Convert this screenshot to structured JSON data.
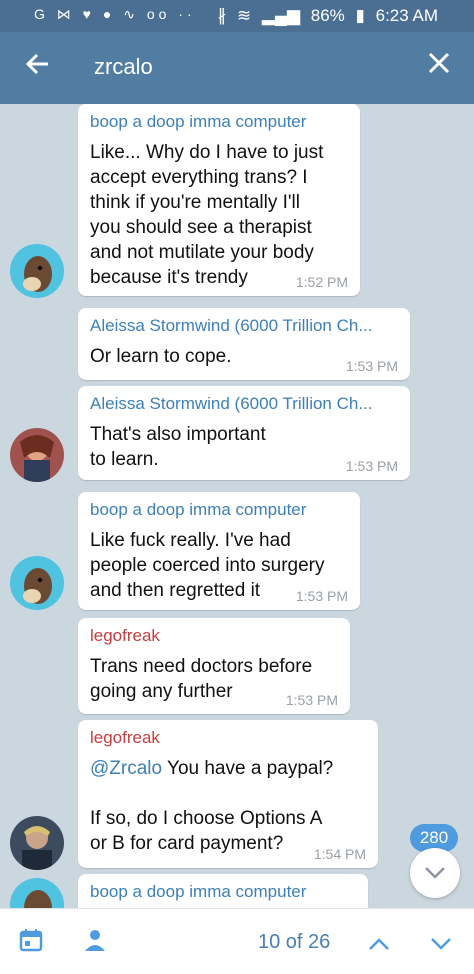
{
  "status_bar": {
    "left_icons": "G ⋈ ♥ ● ∿ oo ··",
    "battery": "86%",
    "time": "6:23 AM"
  },
  "header": {
    "back_icon": "arrow-left",
    "title": "zrcalo",
    "close_icon": "close"
  },
  "messages": [
    {
      "sender": "boop a doop imma computer",
      "text": "Like... Why do I have to just\naccept everything trans? I\nthink if you're mentally I'll\nyou should see a therapist\nand not mutilate your body\nbecause it's trendy",
      "time": "1:52 PM"
    },
    {
      "sender": "Aleissa Stormwind (6000 Trillion Ch...",
      "text": "Or learn to cope.",
      "time": "1:53 PM"
    },
    {
      "sender": "Aleissa Stormwind (6000 Trillion Ch...",
      "text": "That's also important\nto learn.",
      "time": "1:53 PM"
    },
    {
      "sender": "boop a doop imma computer",
      "text": "Like fuck really. I've had\npeople coerced into surgery\nand then regretted it",
      "time": "1:53 PM"
    },
    {
      "sender": "legofreak",
      "text": "Trans need doctors before\ngoing any further",
      "time": "1:53 PM"
    },
    {
      "sender": "legofreak",
      "mention": "@Zrcalo",
      "text": " You have a paypal?\n\nIf so, do I choose Options A\nor B for card payment?",
      "time": "1:54 PM"
    },
    {
      "sender": "boop a doop imma computer",
      "text": "",
      "time": ""
    }
  ],
  "unread_badge": "280",
  "search_nav": {
    "counter": "10 of 26"
  },
  "colors": {
    "header": "#527da3",
    "status_bar": "#4a6f93",
    "sender_blue": "#3d7fb8",
    "sender_red": "#c2403f",
    "accent": "#4f9be0"
  }
}
